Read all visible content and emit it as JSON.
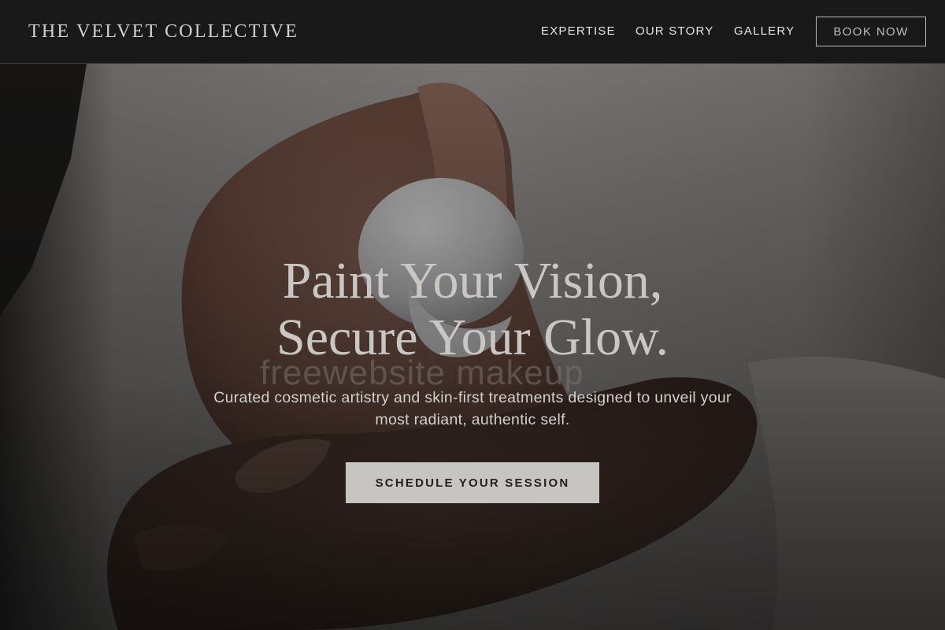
{
  "header": {
    "brand": "THE VELVET COLLECTIVE",
    "nav": [
      {
        "label": "EXPERTISE"
      },
      {
        "label": "OUR STORY"
      },
      {
        "label": "GALLERY"
      }
    ],
    "book_label": "BOOK NOW"
  },
  "hero": {
    "background_image": "hands-squeezing-cosmetic-bottle-photo",
    "watermark": "freewebsite makeup",
    "title_line_1": "Paint Your Vision,",
    "title_line_2": "Secure Your Glow.",
    "subtitle": "Curated cosmetic artistry and skin-first treatments designed to unveil your most radiant, authentic self.",
    "cta_label": "SCHEDULE YOUR SESSION"
  },
  "colors": {
    "header_bg": "#191919",
    "cta_bg": "#c7c5c4",
    "title_text": "#c9c6c4"
  }
}
